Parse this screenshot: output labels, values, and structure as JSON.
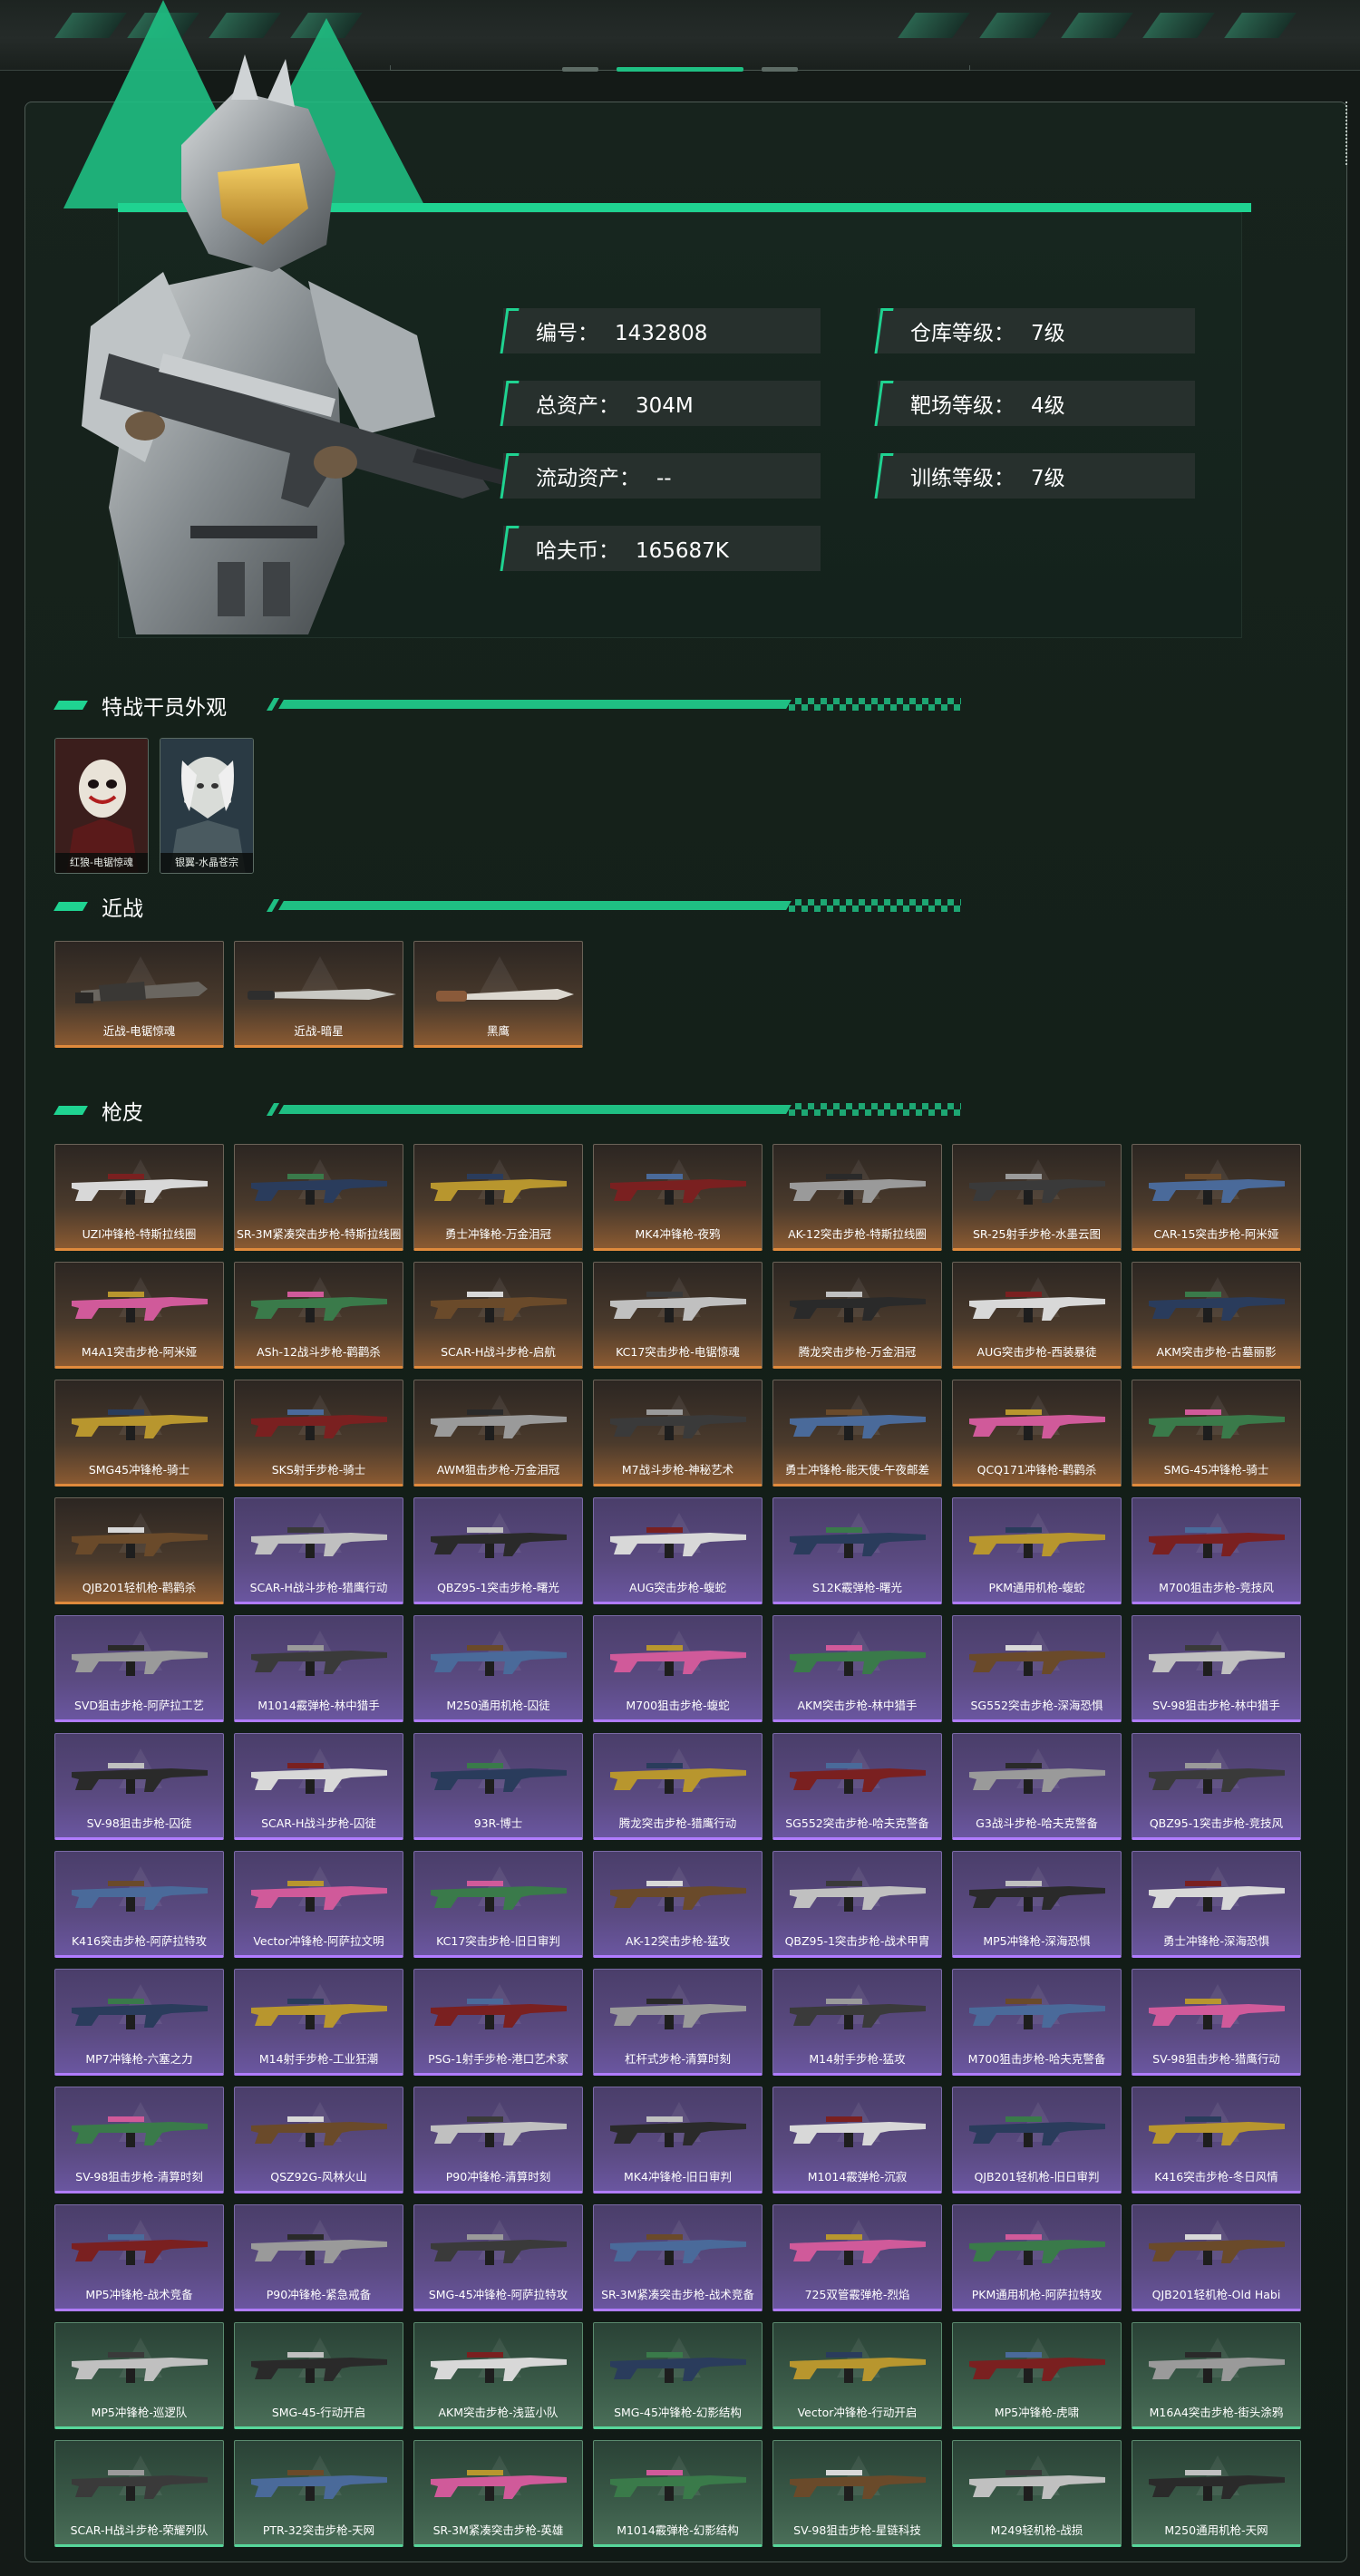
{
  "profile": {
    "stats": [
      {
        "label": "编号：",
        "value": "1432808"
      },
      {
        "label": "仓库等级：",
        "value": "7级"
      },
      {
        "label": "总资产：",
        "value": "304M"
      },
      {
        "label": "靶场等级：",
        "value": "4级"
      },
      {
        "label": "流动资产：",
        "value": "--"
      },
      {
        "label": "训练等级：",
        "value": "7级"
      },
      {
        "label": "哈夫币：",
        "value": "165687K"
      }
    ]
  },
  "sections": {
    "operators": "特战干员外观",
    "melee": "近战",
    "skins": "枪皮"
  },
  "operators": [
    {
      "name": "红狼-电锯惊魂"
    },
    {
      "name": "银翼-水晶苍宗"
    }
  ],
  "melee": [
    {
      "name": "近战-电锯惊魂"
    },
    {
      "name": "近战-暗星"
    },
    {
      "name": "黑鹰"
    }
  ],
  "skins": [
    {
      "name": "UZI冲锋枪-特斯拉线圈",
      "rarity": "orange"
    },
    {
      "name": "SR-3M紧凑突击步枪-特斯拉线圈",
      "rarity": "orange"
    },
    {
      "name": "勇士冲锋枪-万金泪冠",
      "rarity": "orange"
    },
    {
      "name": "MK4冲锋枪-夜鸦",
      "rarity": "orange"
    },
    {
      "name": "AK-12突击步枪-特斯拉线圈",
      "rarity": "orange"
    },
    {
      "name": "SR-25射手步枪-水墨云图",
      "rarity": "orange"
    },
    {
      "name": "CAR-15突击步枪-阿米娅",
      "rarity": "orange"
    },
    {
      "name": "M4A1突击步枪-阿米娅",
      "rarity": "orange"
    },
    {
      "name": "ASh-12战斗步枪-鹳鹳杀",
      "rarity": "orange"
    },
    {
      "name": "SCAR-H战斗步枪-启航",
      "rarity": "orange"
    },
    {
      "name": "KC17突击步枪-电锯惊魂",
      "rarity": "orange"
    },
    {
      "name": "腾龙突击步枪-万金泪冠",
      "rarity": "orange"
    },
    {
      "name": "AUG突击步枪-西装暴徒",
      "rarity": "orange"
    },
    {
      "name": "AKM突击步枪-古墓丽影",
      "rarity": "orange"
    },
    {
      "name": "SMG45冲锋枪-骑士",
      "rarity": "orange"
    },
    {
      "name": "SKS射手步枪-骑士",
      "rarity": "orange"
    },
    {
      "name": "AWM狙击步枪-万金泪冠",
      "rarity": "orange"
    },
    {
      "name": "M7战斗步枪-神秘艺术",
      "rarity": "orange"
    },
    {
      "name": "勇士冲锋枪-能天使-午夜邮差",
      "rarity": "orange"
    },
    {
      "name": "QCQ171冲锋枪-鹳鹳杀",
      "rarity": "orange"
    },
    {
      "name": "SMG-45冲锋枪-骑士",
      "rarity": "orange"
    },
    {
      "name": "QJB201轻机枪-鹳鹳杀",
      "rarity": "orange"
    },
    {
      "name": "SCAR-H战斗步枪-猎鹰行动",
      "rarity": "purple"
    },
    {
      "name": "QBZ95-1突击步枪-曙光",
      "rarity": "purple"
    },
    {
      "name": "AUG突击步枪-蝮蛇",
      "rarity": "purple"
    },
    {
      "name": "S12K霰弹枪-曙光",
      "rarity": "purple"
    },
    {
      "name": "PKM通用机枪-蝮蛇",
      "rarity": "purple"
    },
    {
      "name": "M700狙击步枪-竞技风",
      "rarity": "purple"
    },
    {
      "name": "SVD狙击步枪-阿萨拉工艺",
      "rarity": "purple"
    },
    {
      "name": "M1014霰弹枪-林中猎手",
      "rarity": "purple"
    },
    {
      "name": "M250通用机枪-囚徒",
      "rarity": "purple"
    },
    {
      "name": "M700狙击步枪-蝮蛇",
      "rarity": "purple"
    },
    {
      "name": "AKM突击步枪-林中猎手",
      "rarity": "purple"
    },
    {
      "name": "SG552突击步枪-深海恐惧",
      "rarity": "purple"
    },
    {
      "name": "SV-98狙击步枪-林中猎手",
      "rarity": "purple"
    },
    {
      "name": "SV-98狙击步枪-囚徒",
      "rarity": "purple"
    },
    {
      "name": "SCAR-H战斗步枪-囚徒",
      "rarity": "purple"
    },
    {
      "name": "93R-博士",
      "rarity": "purple"
    },
    {
      "name": "腾龙突击步枪-猎鹰行动",
      "rarity": "purple"
    },
    {
      "name": "SG552突击步枪-哈夫克警备",
      "rarity": "purple"
    },
    {
      "name": "G3战斗步枪-哈夫克警备",
      "rarity": "purple"
    },
    {
      "name": "QBZ95-1突击步枪-竞技风",
      "rarity": "purple"
    },
    {
      "name": "K416突击步枪-阿萨拉特攻",
      "rarity": "purple"
    },
    {
      "name": "Vector冲锋枪-阿萨拉文明",
      "rarity": "purple"
    },
    {
      "name": "KC17突击步枪-旧日审判",
      "rarity": "purple"
    },
    {
      "name": "AK-12突击步枪-猛攻",
      "rarity": "purple"
    },
    {
      "name": "QBZ95-1突击步枪-战术甲胄",
      "rarity": "purple"
    },
    {
      "name": "MP5冲锋枪-深海恐惧",
      "rarity": "purple"
    },
    {
      "name": "勇士冲锋枪-深海恐惧",
      "rarity": "purple"
    },
    {
      "name": "MP7冲锋枪-六塞之力",
      "rarity": "purple"
    },
    {
      "name": "M14射手步枪-工业狂潮",
      "rarity": "purple"
    },
    {
      "name": "PSG-1射手步枪-港口艺术家",
      "rarity": "purple"
    },
    {
      "name": "杠杆式步枪-清算时刻",
      "rarity": "purple"
    },
    {
      "name": "M14射手步枪-猛攻",
      "rarity": "purple"
    },
    {
      "name": "M700狙击步枪-哈夫克警备",
      "rarity": "purple"
    },
    {
      "name": "SV-98狙击步枪-猎鹰行动",
      "rarity": "purple"
    },
    {
      "name": "SV-98狙击步枪-清算时刻",
      "rarity": "purple"
    },
    {
      "name": "QSZ92G-风林火山",
      "rarity": "purple"
    },
    {
      "name": "P90冲锋枪-清算时刻",
      "rarity": "purple"
    },
    {
      "name": "MK4冲锋枪-旧日审判",
      "rarity": "purple"
    },
    {
      "name": "M1014霰弹枪-沉寂",
      "rarity": "purple"
    },
    {
      "name": "QJB201轻机枪-旧日审判",
      "rarity": "purple"
    },
    {
      "name": "K416突击步枪-冬日风情",
      "rarity": "purple"
    },
    {
      "name": "MP5冲锋枪-战术竞备",
      "rarity": "purple"
    },
    {
      "name": "P90冲锋枪-紧急戒备",
      "rarity": "purple"
    },
    {
      "name": "SMG-45冲锋枪-阿萨拉特攻",
      "rarity": "purple"
    },
    {
      "name": "SR-3M紧凑突击步枪-战术竞备",
      "rarity": "purple"
    },
    {
      "name": "725双管霰弹枪-烈焰",
      "rarity": "purple"
    },
    {
      "name": "PKM通用机枪-阿萨拉特攻",
      "rarity": "purple"
    },
    {
      "name": "QJB201轻机枪-Old Habi",
      "rarity": "purple"
    },
    {
      "name": "MP5冲锋枪-巡逻队",
      "rarity": "green"
    },
    {
      "name": "SMG-45-行动开启",
      "rarity": "green"
    },
    {
      "name": "AKM突击步枪-浅蓝小队",
      "rarity": "green"
    },
    {
      "name": "SMG-45冲锋枪-幻影结构",
      "rarity": "green"
    },
    {
      "name": "Vector冲锋枪-行动开启",
      "rarity": "green"
    },
    {
      "name": "MP5冲锋枪-虎啸",
      "rarity": "green"
    },
    {
      "name": "M16A4突击步枪-街头涂鸦",
      "rarity": "green"
    },
    {
      "name": "SCAR-H战斗步枪-荣耀列队",
      "rarity": "green"
    },
    {
      "name": "PTR-32突击步枪-天网",
      "rarity": "green"
    },
    {
      "name": "SR-3M紧凑突击步枪-英雄",
      "rarity": "green"
    },
    {
      "name": "M1014霰弹枪-幻影结构",
      "rarity": "green"
    },
    {
      "name": "SV-98狙击步枪-星链科技",
      "rarity": "green"
    },
    {
      "name": "M249轻机枪-战损",
      "rarity": "green"
    },
    {
      "name": "M250通用机枪-天网",
      "rarity": "green"
    }
  ],
  "colors": {
    "accent": "#1fd391",
    "orange_rarity": "#e08a3c",
    "purple_rarity": "#b07cff",
    "green_rarity": "#57d69a"
  }
}
